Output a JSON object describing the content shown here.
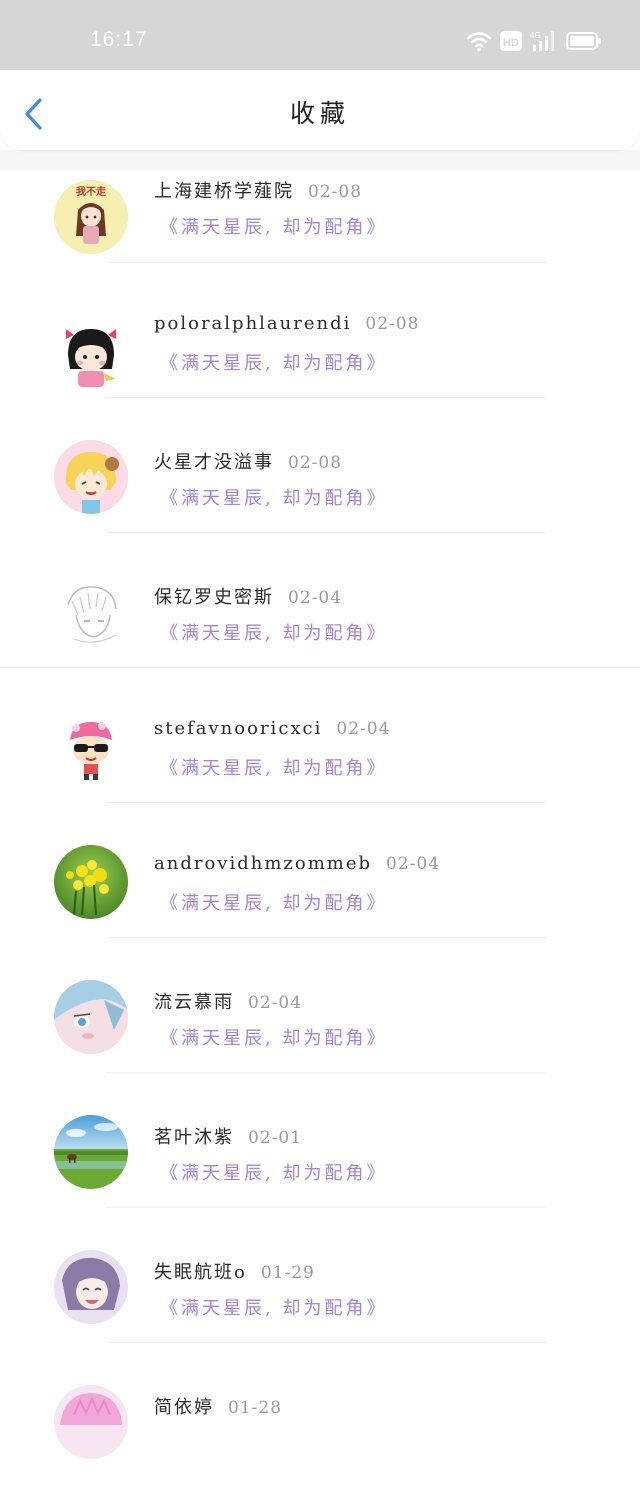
{
  "status_bar": {
    "time": "16:17",
    "icons": [
      "wifi-icon",
      "hd-icon",
      "signal-4g-icon",
      "battery-icon"
    ],
    "hd_label": "HD",
    "net_label": "4G"
  },
  "header": {
    "title": "收藏",
    "back_icon": "chevron-left-icon",
    "accent": "#3b8ee0"
  },
  "colors": {
    "subtitle": "#a683d6",
    "date": "#9a9a9a"
  },
  "items": [
    {
      "name": "上海建桥学薤院",
      "date": "02-08",
      "subtitle": "《满天星辰, 却为配角》",
      "avatar": "cartoon-girl-avatar",
      "avatar_caption": "我不走"
    },
    {
      "name": "poloralphlaurendi",
      "date": "02-08",
      "subtitle": "《满天星辰, 却为配角》",
      "avatar": "cartoon-girl-bow-avatar"
    },
    {
      "name": "火星才没溢事",
      "date": "02-08",
      "subtitle": "《满天星辰, 却为配角》",
      "avatar": "anime-blonde-avatar"
    },
    {
      "name": "保钇罗史密斯",
      "date": "02-04",
      "subtitle": "《满天星辰, 却为配角》",
      "avatar": "sketch-boy-avatar"
    },
    {
      "name": "stefavnooricxci",
      "date": "02-04",
      "subtitle": "《满天星辰, 却为配角》",
      "avatar": "sunglasses-character-avatar"
    },
    {
      "name": "androvidhmzommeb",
      "date": "02-04",
      "subtitle": "《满天星辰, 却为配角》",
      "avatar": "yellow-flowers-avatar"
    },
    {
      "name": "流云慕雨",
      "date": "02-04",
      "subtitle": "《满天星辰, 却为配角》",
      "avatar": "anime-blue-hair-avatar"
    },
    {
      "name": "茗叶沐紫",
      "date": "02-01",
      "subtitle": "《满天星辰, 却为配角》",
      "avatar": "meadow-landscape-avatar"
    },
    {
      "name": "失眠航班o",
      "date": "01-29",
      "subtitle": "《满天星辰, 却为配角》",
      "avatar": "anime-smile-avatar"
    },
    {
      "name": "简依婷",
      "date": "01-28",
      "subtitle": "",
      "avatar": "anime-pink-avatar"
    }
  ]
}
